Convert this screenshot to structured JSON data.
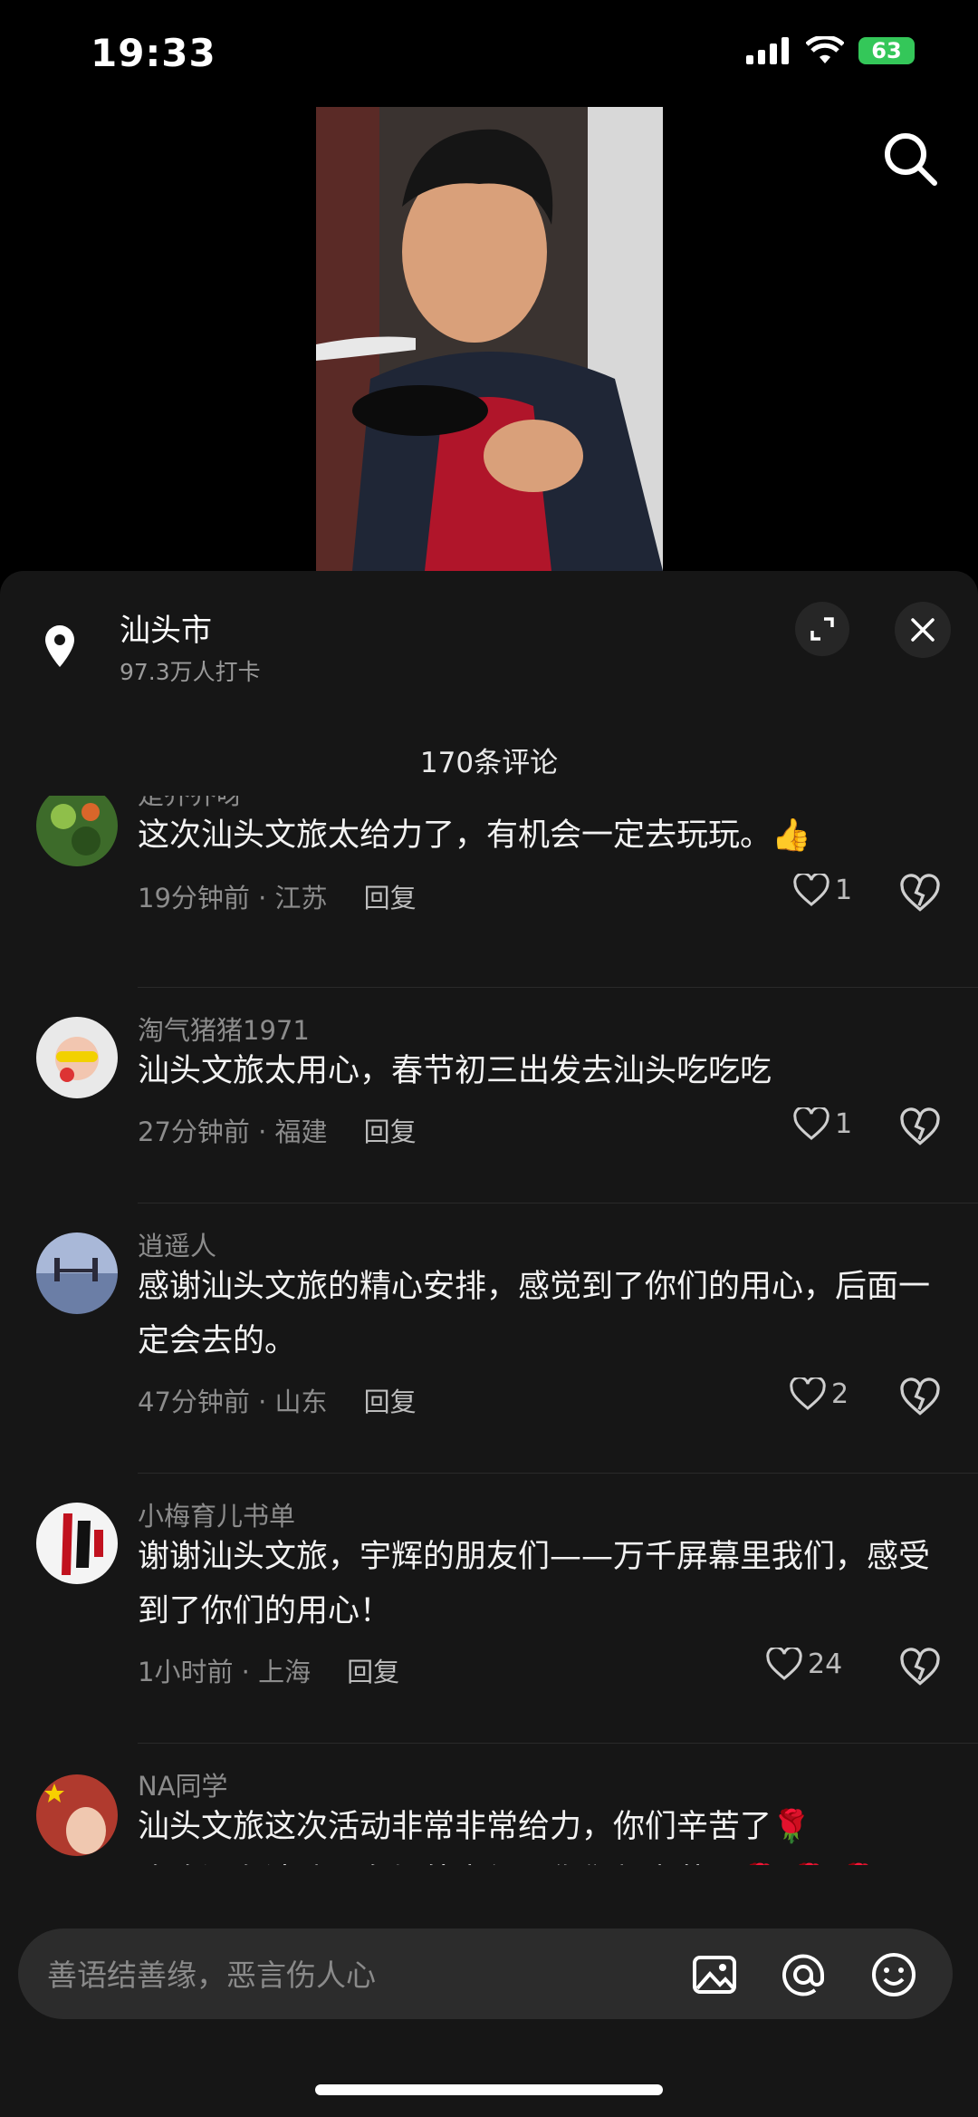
{
  "status": {
    "time": "19:33",
    "battery": "63"
  },
  "location": {
    "name": "汕头市",
    "checkins": "97.3万人打卡"
  },
  "comments_header": {
    "count_text": "170条评论"
  },
  "comments": [
    {
      "username": "是乔乔呀",
      "text": "这次汕头文旅太给力了，有机会一定去玩玩。👍",
      "time_place": "19分钟前 · 江苏",
      "reply": "回复",
      "likes": "1"
    },
    {
      "username": "淘气猪猪1971",
      "text": "汕头文旅太用心，春节初三出发去汕头吃吃吃",
      "time_place": "27分钟前 · 福建",
      "reply": "回复",
      "likes": "1"
    },
    {
      "username": "逍遥人",
      "text": "感谢汕头文旅的精心安排，感觉到了你们的用心，后面一定会去的。",
      "time_place": "47分钟前 · 山东",
      "reply": "回复",
      "likes": "2"
    },
    {
      "username": "小梅育儿书单",
      "text": "谢谢汕头文旅，宇辉的朋友们——万千屏幕里我们，感受到了你们的用心！",
      "time_place": "1小时前 · 上海",
      "reply": "回复",
      "likes": "24"
    },
    {
      "username": "NA同学",
      "text_line1": "汕头文旅这次活动非常非常给力，你们辛苦了🌹",
      "text_line2": "昨晚还有消防员在场外守候，你们都辛苦了🌹 🌹 🌹"
    }
  ],
  "input": {
    "placeholder": "善语结善缘，恶言伤人心"
  }
}
